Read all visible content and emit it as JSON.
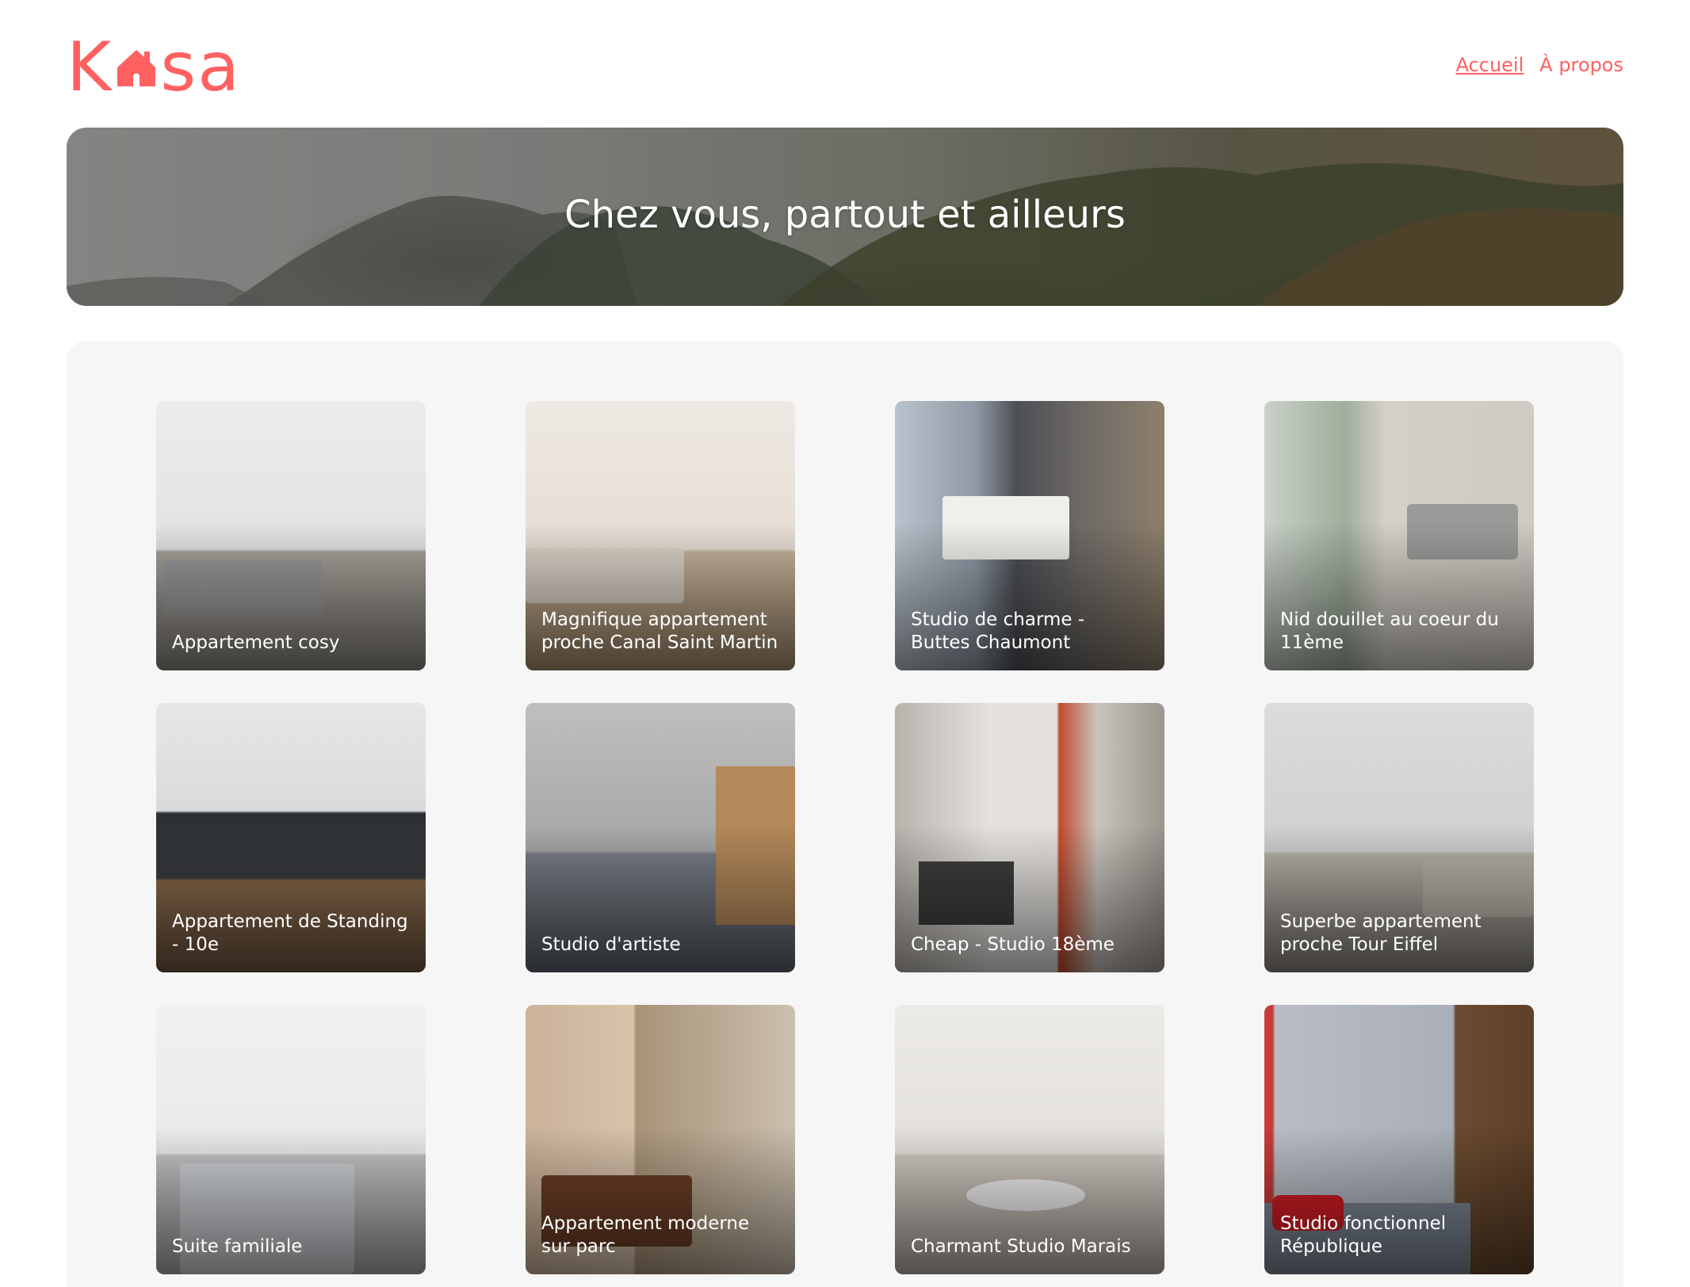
{
  "header": {
    "logo": {
      "letters_before": "K",
      "letters_after": "sa",
      "house_icon": "house-icon",
      "color": "#FF6060"
    },
    "nav": [
      {
        "label": "Accueil",
        "active": true
      },
      {
        "label": "À propos",
        "active": false
      }
    ]
  },
  "banner": {
    "title": "Chez vous, partout et ailleurs"
  },
  "gallery": {
    "cards": [
      {
        "title": "Appartement cosy"
      },
      {
        "title": "Magnifique appartement proche Canal Saint Martin"
      },
      {
        "title": "Studio de charme - Buttes Chaumont"
      },
      {
        "title": "Nid douillet au coeur du 11ème"
      },
      {
        "title": "Appartement de Standing - 10e"
      },
      {
        "title": "Studio d'artiste"
      },
      {
        "title": "Cheap - Studio 18ème"
      },
      {
        "title": "Superbe appartement proche Tour Eiffel"
      },
      {
        "title": "Suite familiale"
      },
      {
        "title": "Appartement moderne sur parc"
      },
      {
        "title": "Charmant Studio Marais"
      },
      {
        "title": "Studio fonctionnel République"
      }
    ]
  },
  "colors": {
    "accent": "#FF6060",
    "gallery_bg": "#F6F6F6"
  }
}
